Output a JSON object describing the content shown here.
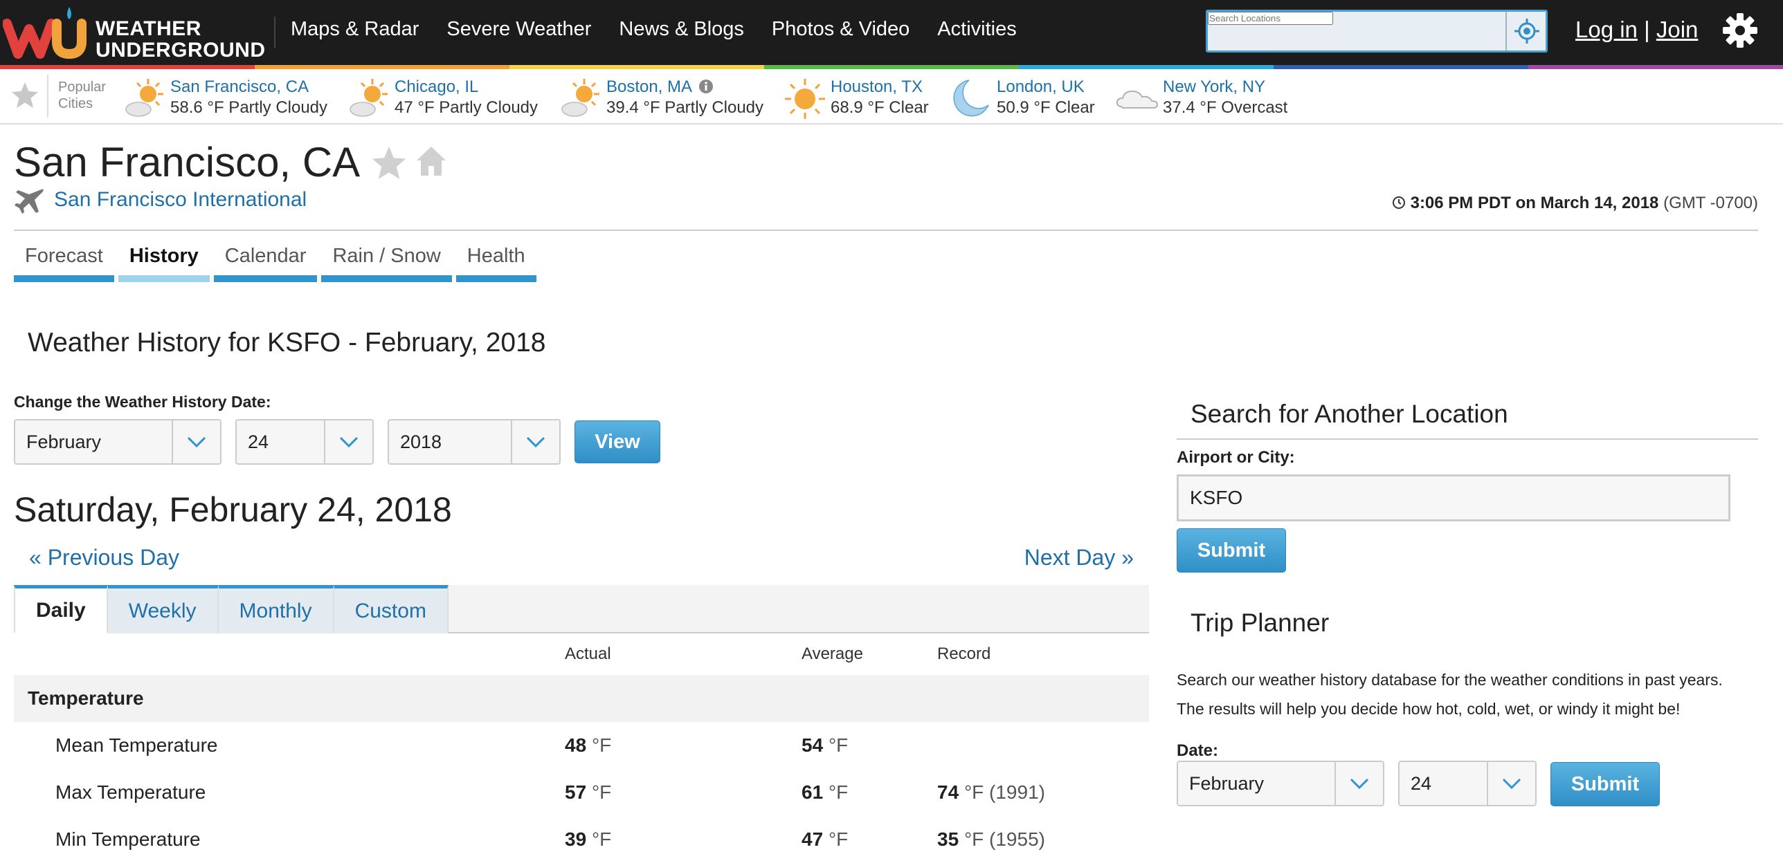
{
  "header": {
    "logo_line1": "WEATHER",
    "logo_line2": "UNDERGROUND",
    "nav": [
      "Maps & Radar",
      "Severe Weather",
      "News & Blogs",
      "Photos & Video",
      "Activities"
    ],
    "search_placeholder": "Search Locations",
    "login": "Log in",
    "separator": "|",
    "join": "Join"
  },
  "popular": {
    "label_line1": "Popular",
    "label_line2": "Cities",
    "cities": [
      {
        "name": "San Francisco, CA",
        "wx": "58.6 °F Partly Cloudy",
        "icon": "partly-cloudy-icon"
      },
      {
        "name": "Chicago, IL",
        "wx": "47 °F Partly Cloudy",
        "icon": "partly-cloudy-icon"
      },
      {
        "name": "Boston, MA",
        "wx": "39.4 °F Partly Cloudy",
        "icon": "partly-cloudy-icon"
      },
      {
        "name": "Houston, TX",
        "wx": "68.9 °F Clear",
        "icon": "sun-icon"
      },
      {
        "name": "London, UK",
        "wx": "50.9 °F Clear",
        "icon": "moon-icon"
      },
      {
        "name": "New York, NY",
        "wx": "37.4 °F Overcast",
        "icon": "cloud-icon"
      }
    ]
  },
  "location": {
    "title": "San Francisco, CA",
    "station": "San Francisco International",
    "time": "3:06 PM PDT on March 14, 2018",
    "gmt": "(GMT -0700)"
  },
  "tabs": [
    "Forecast",
    "History",
    "Calendar",
    "Rain / Snow",
    "Health"
  ],
  "active_tab": "History",
  "history": {
    "title": "Weather History for KSFO - February, 2018",
    "change_label": "Change the Weather History Date:",
    "month": "February",
    "day": "24",
    "year": "2018",
    "view_label": "View",
    "date_heading": "Saturday, February 24, 2018",
    "prev_day": "« Previous Day",
    "next_day": "Next Day »",
    "subtabs": [
      "Daily",
      "Weekly",
      "Monthly",
      "Custom"
    ],
    "columns": {
      "actual": "Actual",
      "average": "Average",
      "record": "Record"
    },
    "section": "Temperature",
    "rows": [
      {
        "label": "Mean Temperature",
        "actual": "48",
        "average": "54",
        "record": "",
        "record_year": ""
      },
      {
        "label": "Max Temperature",
        "actual": "57",
        "average": "61",
        "record": "74",
        "record_year": "(1991)"
      },
      {
        "label": "Min Temperature",
        "actual": "39",
        "average": "47",
        "record": "35",
        "record_year": "(1955)"
      }
    ],
    "unit": "°F"
  },
  "search_panel": {
    "title": "Search for Another Location",
    "label": "Airport or City:",
    "value": "KSFO",
    "submit": "Submit"
  },
  "trip_planner": {
    "title": "Trip Planner",
    "text_line1": "Search our weather history database for the weather conditions in past years.",
    "text_line2": "The results will help you decide how hot, cold, wet, or windy it might be!",
    "date_label": "Date:",
    "month": "February",
    "day": "24",
    "submit": "Submit"
  },
  "colors": {
    "header_bg": "#1c1c1c",
    "link": "#1e70aa",
    "tab_accent": "#2f95cc",
    "rainbow": [
      "#e2423d",
      "#f2a23a",
      "#f4d34a",
      "#5bb747",
      "#2fa9d9",
      "#2f5fae",
      "#9b4ea0"
    ]
  }
}
